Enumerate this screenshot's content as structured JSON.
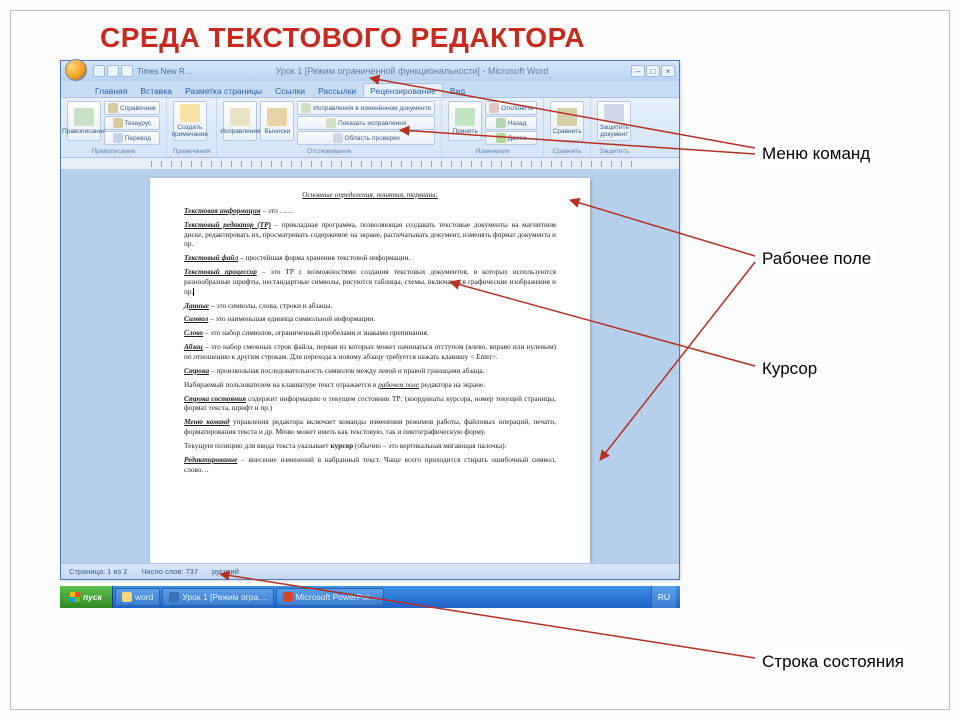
{
  "slide": {
    "title": "СРЕДА ТЕКСТОВОГО РЕДАКТОРА"
  },
  "labels": {
    "menu": "Меню команд",
    "workfield": "Рабочее поле",
    "cursor": "Курсор",
    "statusbar": "Строка состояния"
  },
  "window": {
    "qat_font": "Times New R…",
    "doc_title": "Урок 1 [Режим ограниченной функциональности] - Microsoft Word",
    "tabs": [
      "Главная",
      "Вставка",
      "Разметка страницы",
      "Ссылки",
      "Рассылки",
      "Рецензирование",
      "Вид"
    ],
    "active_tab_index": 5,
    "ribbon": {
      "g1": {
        "label": "Правописание",
        "big": "Правописание",
        "items": [
          "Справочник",
          "Тезаурус",
          "Перевод"
        ]
      },
      "g2": {
        "label": "Примечания",
        "big": "Создать примечание"
      },
      "g3": {
        "label": "Отслеживание",
        "big": "Исправления",
        "big2": "Выноски",
        "items": [
          "Исправления в изменённом документе",
          "Показать исправления",
          "Область проверки"
        ]
      },
      "g4": {
        "label": "Изменения",
        "big": "Принять",
        "items": [
          "Отклонить",
          "Назад",
          "Далее"
        ]
      },
      "g5": {
        "label": "Сравнить",
        "big": "Сравнить"
      },
      "g6": {
        "label": "Защитить",
        "big": "Защитить документ"
      }
    },
    "status": {
      "page": "Страница: 1 из 2",
      "words": "Число слов: 737",
      "lang": "русский"
    }
  },
  "doc": {
    "heading": "Основные определения, понятия, термины:",
    "p1a": "Текстовая информация",
    "p1b": " – это ……",
    "p2a": "Текстовый редактор (ТР)",
    "p2b": " – прикладная программа, позволяющая создавать текстовые документы на магнитном диске, редактировать их, просматривать содержимое на экране, распечатывать документ, изменять формат документа и пр.",
    "p3a": "Текстовый файл",
    "p3b": " – простейшая форма хранения текстовой информации.",
    "p4a": "Текстовый процессор",
    "p4b": " – это ТР с возможностями создания текстовых документов, в которых используются разнообразные шрифты, нестандартные символы, рисуются таблицы, схемы, включаются графические изображения и пр.",
    "p5a": "Данные",
    "p5b": " – это символы, слова, строки и абзацы.",
    "p6a": "Символ",
    "p6b": " – это наименьшая единица символьной информации.",
    "p7a": "Слово",
    "p7b": " – это набор символов, ограниченный пробелами и знаками препинания.",
    "p8a": "Абзац",
    "p8b": " – это набор смежных строк файла, первая из которых может начинаться отступом (влево, вправо или нулевым) по отношению к другим строкам. Для перехода к новому абзацу требуется нажать клавишу < Enter>.",
    "p9a": "Строка",
    "p9b": " – произвольная последовательность символов между левой и правой границами абзаца.",
    "p10": "Набираемый пользователем на клавиатуре текст отражается в ",
    "p10u": "рабочем поле",
    "p10c": " редактора на экране.",
    "p11a": "Строка состояния",
    "p11b": " содержит информацию о текущем состоянии ТР: (координаты курсора, номер текущей страницы, формат текста, шрифт и пр.)",
    "p12a": "Меню команд",
    "p12b": " управления редактора включает команды изменения режимов работы, файловых операций, печати, форматирования текста и др. Меню может иметь как текстовую, так и пиктографическую форму.",
    "p13a": "Текущую позицию для ввода текста указывает ",
    "p13b": "курсор",
    "p13c": " (обычно – это вертикальная мигающая палочка).",
    "p14a": "Редактирование",
    "p14b": " – внесение изменений в набранный текст. Чаще всего приходится стирать ошибочный символ, слово…"
  },
  "taskbar": {
    "start": "пуск",
    "t1": "word",
    "t2": "Урок 1 [Режим огра…",
    "t3": "Microsoft PowerPoi…",
    "lang": "RU"
  }
}
